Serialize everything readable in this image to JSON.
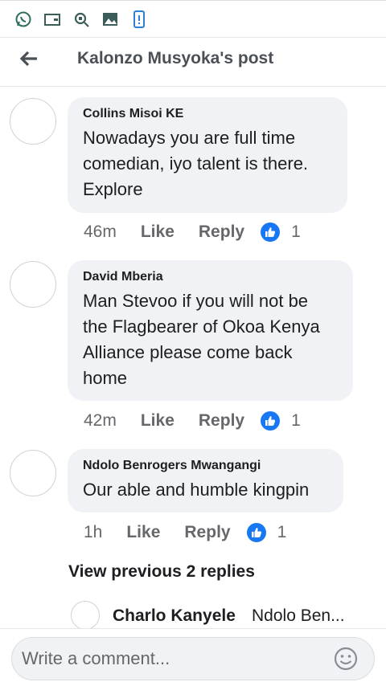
{
  "status_icons": [
    "whatsapp-icon",
    "wallet-icon",
    "search-icon",
    "image-icon",
    "phone-icon"
  ],
  "header": {
    "title": "Kalonzo Musyoka's post"
  },
  "comments": [
    {
      "author": "Collins Misoi KE",
      "lines": [
        "Nowadays you are full time",
        "comedian, iyo talent is there.",
        "Explore"
      ],
      "time": "46m",
      "like": "Like",
      "reply": "Reply",
      "reactions": "1"
    },
    {
      "author": "David Mberia",
      "lines": [
        "Man Stevoo if you will not be",
        "the Flagbearer of Okoa Kenya",
        "Alliance please come back",
        "home"
      ],
      "time": "42m",
      "like": "Like",
      "reply": "Reply",
      "reactions": "1"
    },
    {
      "author": "Ndolo Benrogers Mwangangi",
      "lines": [
        "Our able and humble kingpin"
      ],
      "time": "1h",
      "like": "Like",
      "reply": "Reply",
      "reactions": "1"
    }
  ],
  "view_previous": "View previous 2 replies",
  "reply_preview": {
    "author": "Charlo Kanyele",
    "snippet": "Ndolo Ben..."
  },
  "composer": {
    "placeholder": "Write a comment..."
  },
  "colors": {
    "accent": "#1877f2",
    "bubble": "#f0f2f5",
    "secondary_text": "#65676b"
  }
}
